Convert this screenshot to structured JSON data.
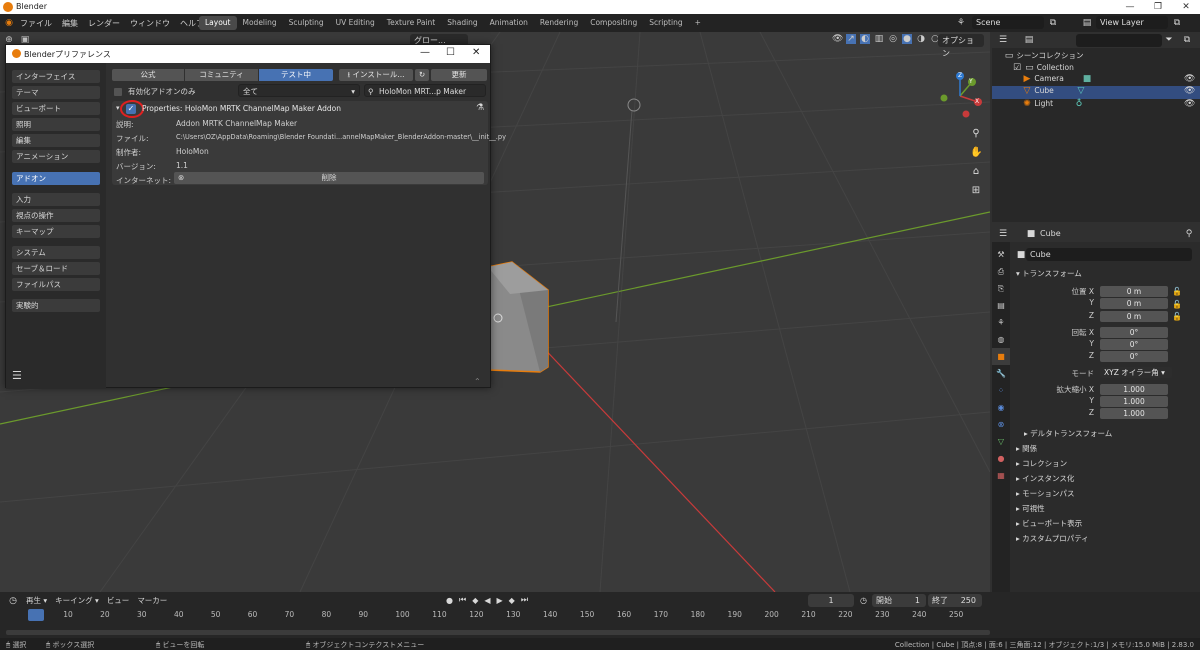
{
  "window": {
    "title": "Blender"
  },
  "menu": [
    "ファイル",
    "編集",
    "レンダー",
    "ウィンドウ",
    "ヘルプ"
  ],
  "workspaces": [
    "Layout",
    "Modeling",
    "Sculpting",
    "UV Editing",
    "Texture Paint",
    "Shading",
    "Animation",
    "Rendering",
    "Compositing",
    "Scripting"
  ],
  "workspace_plus": "+",
  "scene_field": "Scene",
  "view_layer_field": "View Layer",
  "viewport": {
    "orientation": "グロー...",
    "options": "オプション",
    "gizmo_x": "X",
    "gizmo_y": "Y",
    "gizmo_z": "Z"
  },
  "prefs": {
    "title": "Blenderプリファレンス",
    "sidebar": [
      "インターフェイス",
      "テーマ",
      "ビューポート",
      "照明",
      "編集",
      "アニメーション",
      "アドオン",
      "入力",
      "視点の操作",
      "キーマップ",
      "システム",
      "セーブ＆ロード",
      "ファイルパス",
      "実験的"
    ],
    "active_sidebar": "アドオン",
    "tabs": [
      "公式",
      "コミュニティ",
      "テスト中"
    ],
    "install": "インストール...",
    "refresh": "更新",
    "enabled_only": "有効化アドオンのみ",
    "category": "全て",
    "search": "HoloMon MRT...p Maker Addon",
    "addon_title": "Properties: HoloMon MRTK ChannelMap Maker Addon",
    "rows": [
      {
        "k": "説明:",
        "v": "Addon MRTK ChannelMap Maker"
      },
      {
        "k": "ファイル:",
        "v": "C:\\Users\\OZ\\AppData\\Roaming\\Blender Foundati...annelMapMaker_BlenderAddon-master\\__init__.py"
      },
      {
        "k": "制作者:",
        "v": "HoloMon"
      },
      {
        "k": "バージョン:",
        "v": "1.1"
      },
      {
        "k": "インターネット:",
        "v": ""
      }
    ],
    "remove": "削除"
  },
  "outliner": {
    "search": "",
    "root": "シーンコレクション",
    "collection": "Collection",
    "items": [
      "Camera",
      "Cube",
      "Light"
    ]
  },
  "properties": {
    "object_name": "Cube",
    "name_field": "Cube",
    "transform": "トランスフォーム",
    "location_label": "位置 X",
    "location": [
      "0 m",
      "0 m",
      "0 m"
    ],
    "rotation_label": "回転 X",
    "rotation": [
      "0°",
      "0°",
      "0°"
    ],
    "mode_label": "モード",
    "mode": "XYZ オイラー角",
    "scale_label": "拡大縮小 X",
    "scale": [
      "1.000",
      "1.000",
      "1.000"
    ],
    "y": "Y",
    "z": "Z",
    "delta": "デルタトランスフォーム",
    "panels": [
      "関係",
      "コレクション",
      "インスタンス化",
      "モーションパス",
      "可視性",
      "ビューポート表示",
      "カスタムプロパティ"
    ]
  },
  "timeline": {
    "menu": [
      "再生",
      "キーイング",
      "ビュー",
      "マーカー"
    ],
    "current": "1",
    "start_label": "開始",
    "start": "1",
    "end_label": "終了",
    "end": "250",
    "ticks": [
      "1",
      "10",
      "20",
      "30",
      "40",
      "50",
      "60",
      "70",
      "80",
      "90",
      "100",
      "110",
      "120",
      "130",
      "140",
      "150",
      "160",
      "170",
      "180",
      "190",
      "200",
      "210",
      "220",
      "230",
      "240",
      "250"
    ]
  },
  "status": {
    "select": "選択",
    "box_select": "ボックス選択",
    "rotate_view": "ビューを回転",
    "context_menu": "オブジェクトコンテクストメニュー",
    "stats": "Collection | Cube | 頂点:8 | 面:6 | 三角面:12 | オブジェクト:1/3 | メモリ:15.0 MiB | 2.83.0"
  },
  "colors": {
    "accent": "#4772b3",
    "selection": "#e87d0d",
    "x_axis": "#c83a3a",
    "y_axis": "#6b9a2c",
    "z_axis": "#2f7ad1"
  }
}
